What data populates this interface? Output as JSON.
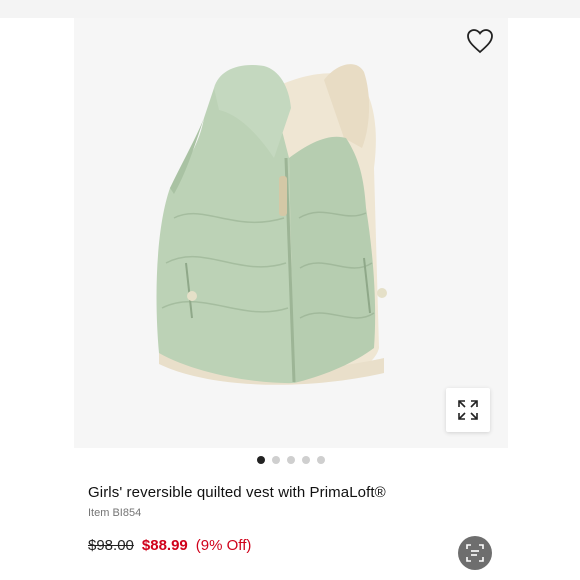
{
  "product": {
    "title": "Girls' reversible quilted vest with PrimaLoft®",
    "item_number": "Item BI854",
    "price_original": "$98.00",
    "price_sale": "$88.99",
    "discount": "(9% Off)"
  },
  "gallery": {
    "image_count": 5,
    "active_index": 0
  },
  "icons": {
    "wishlist": "heart-outline-icon",
    "expand": "expand-arrows-icon",
    "scan": "visual-search-icon"
  },
  "colors": {
    "vest_green": "#bcd2b6",
    "sherpa": "#efe6d3",
    "sale_red": "#d0021b",
    "active_dot": "#222222"
  }
}
